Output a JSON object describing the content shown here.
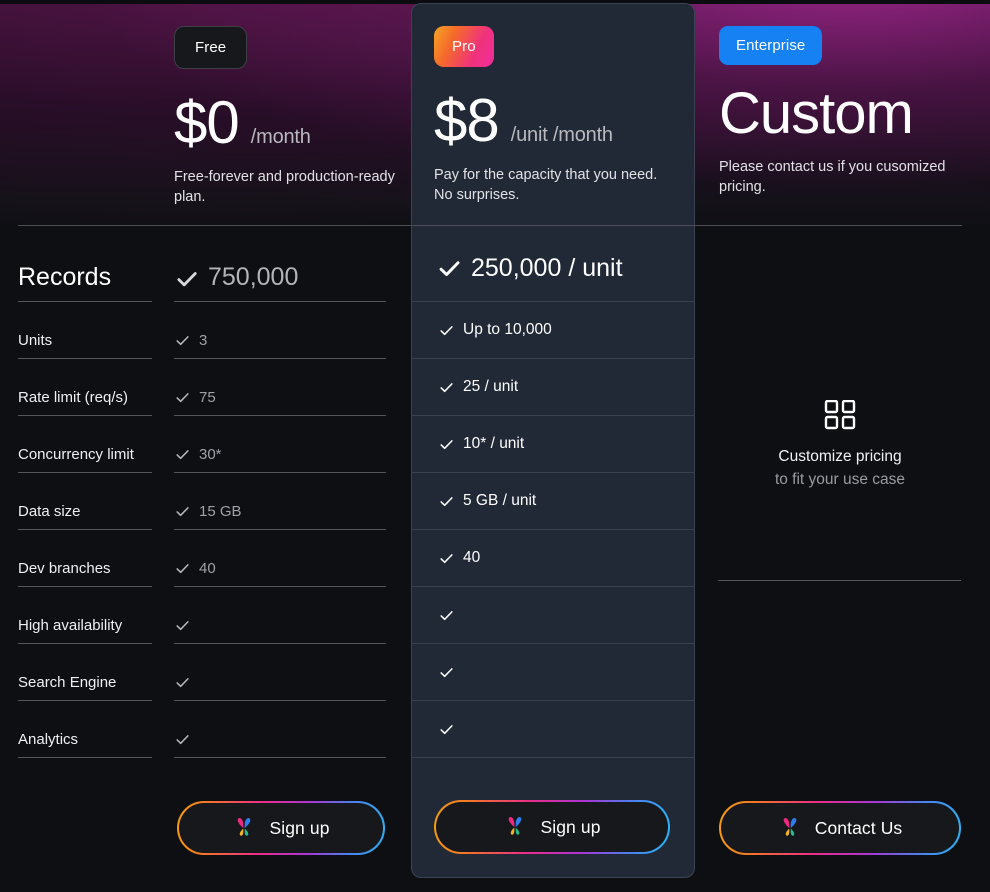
{
  "plans": [
    {
      "id": "free",
      "badge": "Free",
      "price": "$0",
      "price_unit": "/month",
      "blurb": "Free-forever and production-ready plan.",
      "cta": "Sign up"
    },
    {
      "id": "pro",
      "badge": "Pro",
      "price": "$8",
      "price_unit": "/unit /month",
      "blurb": "Pay for the capacity that you need. No surprises.",
      "cta": "Sign up"
    },
    {
      "id": "enterprise",
      "badge": "Enterprise",
      "price": "Custom",
      "price_unit": "",
      "blurb": "Please contact us if you cusomized pricing.",
      "cta": "Contact Us"
    }
  ],
  "features": [
    {
      "label": "Records",
      "free": "750,000",
      "pro": "250,000 / unit"
    },
    {
      "label": "Units",
      "free": "3",
      "pro": "Up to 10,000"
    },
    {
      "label": "Rate limit (req/s)",
      "free": "75",
      "pro": "25 / unit"
    },
    {
      "label": "Concurrency limit",
      "free": "30*",
      "pro": "10* / unit"
    },
    {
      "label": "Data size",
      "free": "15 GB",
      "pro": "5 GB / unit"
    },
    {
      "label": "Dev branches",
      "free": "40",
      "pro": "40"
    },
    {
      "label": "High availability",
      "free": "",
      "pro": ""
    },
    {
      "label": "Search Engine",
      "free": "",
      "pro": ""
    },
    {
      "label": "Analytics",
      "free": "",
      "pro": ""
    }
  ],
  "enterprise_panel": {
    "icon": "grid-2x2-icon",
    "line1": "Customize pricing",
    "line2": "to fit your use case"
  },
  "icons": {
    "check": "check-icon",
    "brand": "butterfly-logo"
  },
  "colors": {
    "badge_enterprise": "#1581f2",
    "badge_pro_from": "#f5a524",
    "badge_pro_to": "#ef2d9e",
    "pro_card_bg": "#212936",
    "page_bg": "#0e0f13",
    "free_value_text": "#a0a0a6",
    "pro_value_text": "#ffffff"
  }
}
